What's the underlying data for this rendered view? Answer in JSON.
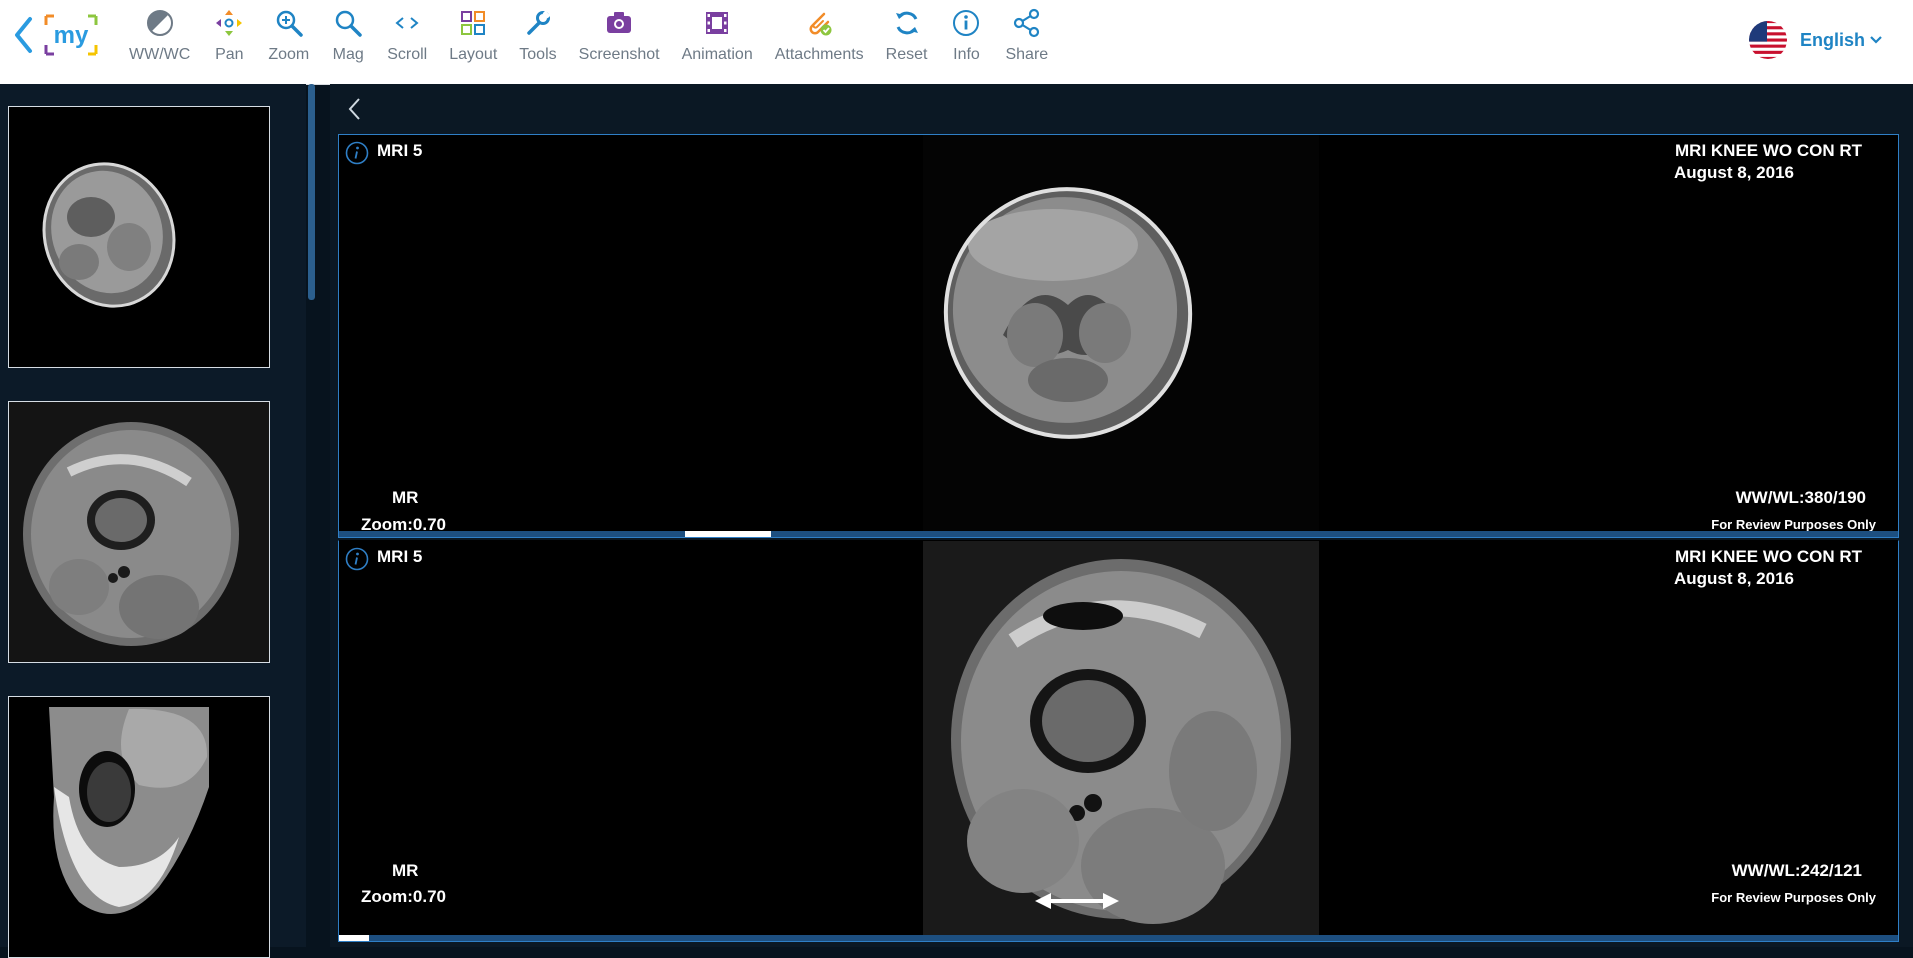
{
  "toolbar": {
    "logo_text": "my",
    "tools": [
      {
        "label": "WW/WC",
        "icon": "contrast-icon"
      },
      {
        "label": "Pan",
        "icon": "pan-arrows-icon"
      },
      {
        "label": "Zoom",
        "icon": "zoom-icon"
      },
      {
        "label": "Mag",
        "icon": "magnifier-icon"
      },
      {
        "label": "Scroll",
        "icon": "scroll-arrows-icon"
      },
      {
        "label": "Layout",
        "icon": "layout-grid-icon"
      },
      {
        "label": "Tools",
        "icon": "wrench-icon"
      },
      {
        "label": "Screenshot",
        "icon": "camera-icon"
      },
      {
        "label": "Animation",
        "icon": "film-icon"
      },
      {
        "label": "Attachments",
        "icon": "paperclip-icon"
      },
      {
        "label": "Reset",
        "icon": "reset-icon"
      },
      {
        "label": "Info",
        "icon": "info-icon"
      },
      {
        "label": "Share",
        "icon": "share-icon"
      }
    ],
    "language": "English",
    "colors": {
      "accent": "#1f84c4",
      "label": "#6e7a86"
    }
  },
  "viewports": [
    {
      "series": "MRI 5",
      "study": "MRI KNEE WO CON RT",
      "date": "August 8, 2016",
      "modality": "MR",
      "zoom": "Zoom:0.70",
      "wwwl": "WW/WL:380/190",
      "notice": "For Review Purposes Only"
    },
    {
      "series": "MRI 5",
      "study": "MRI KNEE WO CON RT",
      "date": "August 8, 2016",
      "modality": "MR",
      "zoom": "Zoom:0.70",
      "wwwl": "WW/WL:242/121",
      "notice": "For Review Purposes Only"
    }
  ]
}
